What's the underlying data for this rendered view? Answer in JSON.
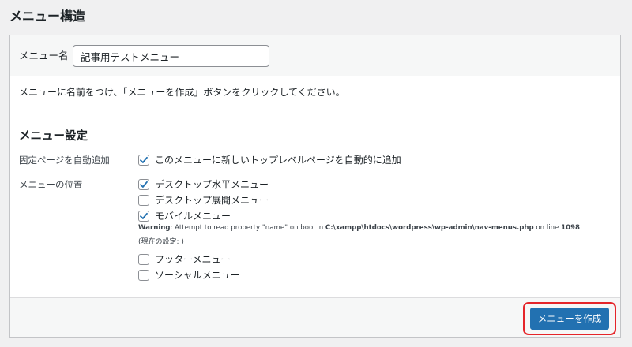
{
  "header": {
    "title": "メニュー構造"
  },
  "menu_name": {
    "label": "メニュー名",
    "value": "記事用テストメニュー"
  },
  "instruction": "メニューに名前をつけ、「メニューを作成」ボタンをクリックしてください。",
  "settings": {
    "heading": "メニュー設定",
    "auto_add": {
      "label": "固定ページを自動追加",
      "option": {
        "label": "このメニューに新しいトップレベルページを自動的に追加",
        "checked": true
      }
    },
    "locations": {
      "label": "メニューの位置",
      "options": [
        {
          "label": "デスクトップ水平メニュー",
          "checked": true
        },
        {
          "label": "デスクトップ展開メニュー",
          "checked": false
        },
        {
          "label": "モバイルメニュー",
          "checked": true
        },
        {
          "label": "フッターメニュー",
          "checked": false
        },
        {
          "label": "ソーシャルメニュー",
          "checked": false
        }
      ],
      "warning": {
        "prefix": "Warning",
        "message": ": Attempt to read property \"name\" on bool in ",
        "path": "C:\\xampp\\htdocs\\wordpress\\wp-admin\\nav-menus.php",
        "line_text": " on line ",
        "line": "1098"
      },
      "current_setting": "(現在の設定: )"
    }
  },
  "footer": {
    "create_label": "メニューを作成"
  },
  "colors": {
    "primary": "#2271b1",
    "highlight": "#e5252a",
    "check": "#2271b1"
  }
}
